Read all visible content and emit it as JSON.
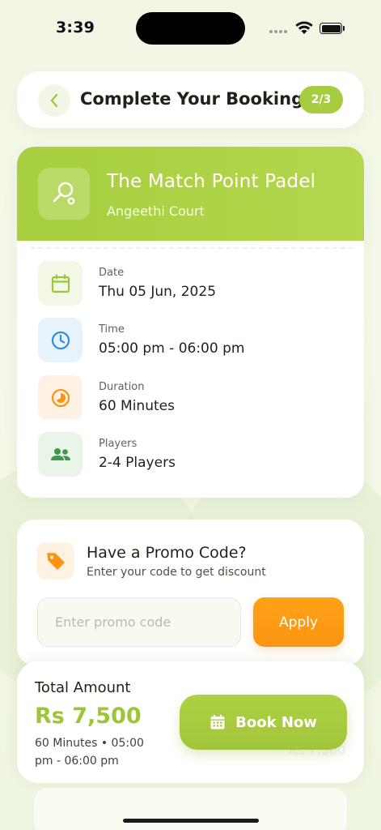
{
  "status_bar": {
    "time": "3:39"
  },
  "header": {
    "title": "Complete Your Booking",
    "step": "2/3"
  },
  "venue": {
    "name": "The Match Point Padel",
    "court": "Angeethi Court",
    "details": [
      {
        "label": "Date",
        "value": "Thu 05 Jun, 2025",
        "icon": "calendar-icon"
      },
      {
        "label": "Time",
        "value": "05:00 pm - 06:00 pm",
        "icon": "clock-icon"
      },
      {
        "label": "Duration",
        "value": "60 Minutes",
        "icon": "timelapse-icon"
      },
      {
        "label": "Players",
        "value": "2-4 Players",
        "icon": "group-icon"
      }
    ]
  },
  "promo": {
    "title": "Have a Promo Code?",
    "subtitle": "Enter your code to get discount",
    "placeholder": "Enter promo code",
    "apply_label": "Apply"
  },
  "checkout": {
    "total_label": "Total Amount",
    "total_amount": "Rs 7,500",
    "details": "60 Minutes • 05:00 pm - 06:00 pm",
    "ghost_amount": "Rs 7,500",
    "book_label": "Book Now"
  },
  "colors": {
    "accent_green": "#a6cc3f",
    "accent_orange": "#fb9413",
    "clock_blue": "#2f8fe0",
    "players_green": "#3d9a4c"
  }
}
